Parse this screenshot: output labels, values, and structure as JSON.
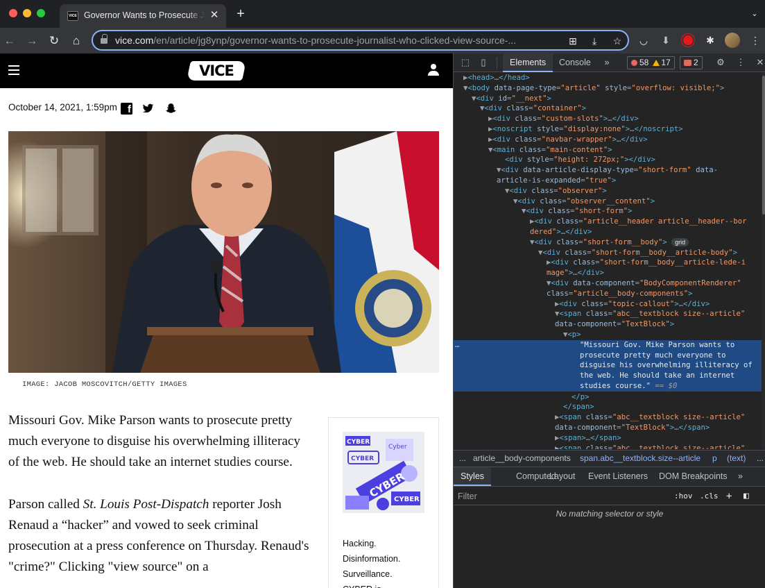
{
  "browser": {
    "tab": {
      "favicon_text": "VICE",
      "title": "Governor Wants to Prosecute Journalist Who Clicked View Source",
      "close_glyph": "✕"
    },
    "new_tab_glyph": "+",
    "tab_menu_glyph": "⌄",
    "nav": {
      "back": "←",
      "forward": "→",
      "reload": "↻",
      "home": "⌂"
    },
    "url_host": "vice.com",
    "url_path": "/en/article/jg8ynp/governor-wants-to-prosecute-journalist-who-clicked-view-source-...",
    "omnibox_icons": {
      "qr": "⊞",
      "install": "⤓",
      "star": "☆"
    },
    "extensions": {
      "pocket": "◡",
      "download": "⬇",
      "puzzle": "✱",
      "menu": "⋮"
    }
  },
  "page": {
    "logo_text": "VICE",
    "dateline": "October 14, 2021, 1:59pm",
    "social": {
      "facebook": "f"
    },
    "image_caption": "IMAGE: JACOB MOSCOVITCH/GETTY IMAGES",
    "paragraphs": {
      "p1": "Missouri Gov. Mike Parson wants to prosecute pretty much everyone to disguise his overwhelming illiteracy of the web. He should take an internet studies course.",
      "p2_before": "Parson called ",
      "p2_em": "St. Louis Post-Dispatch",
      "p2_after": " reporter Josh Renaud a “hacker” and vowed to seek criminal prosecution at a press conference on Thursday. Renaud's \"crime?\" Clicking \"view source\" on a"
    },
    "callout": {
      "image_texts": [
        "CYBER",
        "CYBER",
        "Cyber",
        "CYBER",
        "CYBER"
      ],
      "lines": [
        "Hacking.",
        "Disinformation.",
        "Surveillance.",
        "CYBER is"
      ]
    }
  },
  "devtools": {
    "tabs": {
      "elements": "Elements",
      "console": "Console",
      "more": "»"
    },
    "errors": "58",
    "warnings": "17",
    "issues": "2",
    "icons": {
      "inspect": "⬚",
      "device": "▯",
      "gear": "⚙",
      "kebab": "⋮",
      "close": "✕"
    },
    "breadcrumbs": {
      "more": "...",
      "b1": "article__body-components",
      "b2": "span.abc__textblock.size--article",
      "b3": "p",
      "b4": "(text)",
      "overflow": "..."
    },
    "subtabs": {
      "styles": "Styles",
      "computed": "Computed",
      "layout": "Layout",
      "event_listeners": "Event Listeners",
      "dom_breakpoints": "DOM Breakpoints",
      "more": "»"
    },
    "filter_placeholder": "Filter",
    "hov": ":hov",
    "cls": ".cls",
    "plus": "+",
    "sidebar_toggle": "◧",
    "no_match": "No matching selector or style",
    "grid_badge": "grid",
    "selected_text": [
      "\"Missouri Gov. Mike Parson wants to",
      "prosecute pretty much everyone to",
      "disguise his overwhelming illiteracy of",
      "the web. He should take an internet",
      "studies course.\""
    ],
    "selected_suffix": " == $0"
  }
}
